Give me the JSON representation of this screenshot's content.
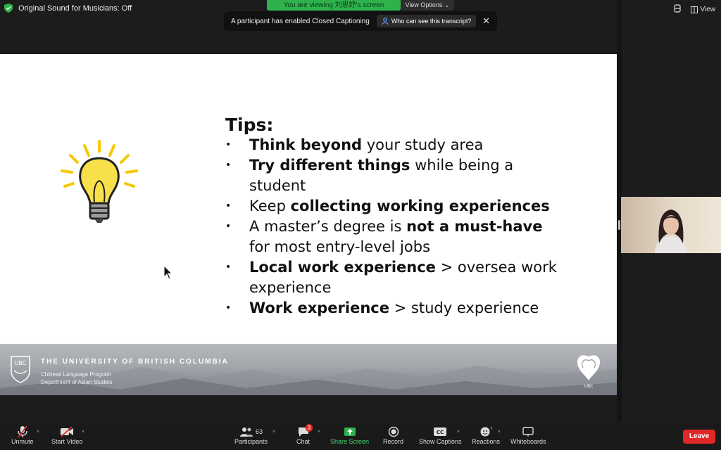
{
  "topbar": {
    "original_sound": "Original Sound for Musicians: Off",
    "viewing_banner": "You are viewing 刘思妤's screen",
    "view_options": "View Options",
    "view_button": "View"
  },
  "cc_notice": {
    "message": "A participant has enabled Closed Captioning",
    "who_button": "Who can see this transcript?"
  },
  "slide": {
    "title": "Tips:",
    "tips": [
      {
        "bold": "Think beyond",
        "rest": " your study area",
        "pre": ""
      },
      {
        "bold": "Try different things",
        "rest": " while being a student",
        "pre": ""
      },
      {
        "pre": "Keep ",
        "bold": "collecting working experiences",
        "rest": ""
      },
      {
        "pre": "A master’s degree is ",
        "bold": "not a must-have",
        "rest": " for most entry-level jobs"
      },
      {
        "pre": "",
        "bold": "Local work experience",
        "rest": " > oversea work experience"
      },
      {
        "pre": "",
        "bold": "Work experience",
        "rest": " > study experience"
      }
    ],
    "university": "THE UNIVERSITY OF BRITISH COLUMBIA",
    "program": "Chinese Language Program",
    "department": "Department of Asian Studies",
    "logo_text": "UBC"
  },
  "toolbar": {
    "unmute": "Unmute",
    "start_video": "Start Video",
    "participants": "Participants",
    "participant_count": "63",
    "chat": "Chat",
    "chat_badge": "3",
    "share_screen": "Share Screen",
    "record": "Record",
    "show_captions": "Show Captions",
    "reactions": "Reactions",
    "whiteboards": "Whiteboards",
    "leave": "Leave"
  },
  "colors": {
    "share_green": "#2fb24c",
    "leave_red": "#e02828"
  }
}
